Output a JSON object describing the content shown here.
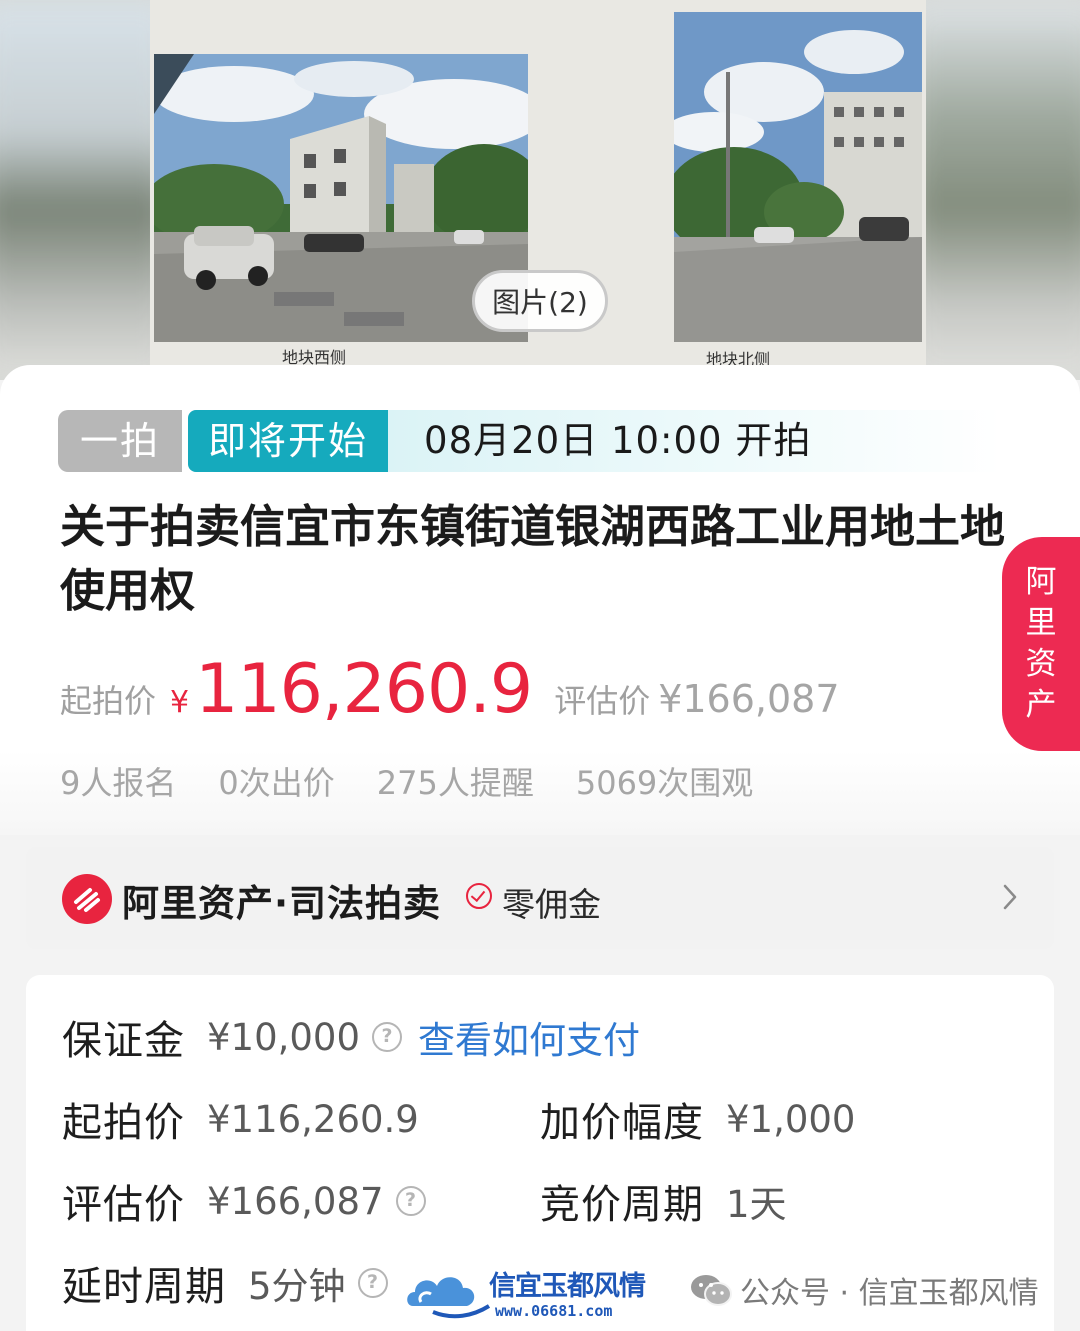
{
  "photo_strip": {
    "caption_left": "地块西侧",
    "caption_right": "地块北侧",
    "pager_label": "图片(2)"
  },
  "auction": {
    "round_tag": "一拍",
    "status_tag": "即将开始",
    "start_time": "08月20日 10:00 开拍",
    "title": "关于拍卖信宜市东镇街道银湖西路工业用地土地使用权",
    "starting_price_label": "起拍价",
    "currency": "¥",
    "starting_price": "116,260.9",
    "appraised_price_label": "评估价",
    "appraised_price": "¥166,087",
    "stats": [
      "9人报名",
      "0次出价",
      "275人提醒",
      "5069次围观"
    ],
    "side_tab_chars": [
      "阿",
      "里",
      "资",
      "产"
    ]
  },
  "platform": {
    "name": "阿里资产·司法拍卖",
    "badge": "零佣金"
  },
  "details": {
    "deposit_label": "保证金",
    "deposit_value": "¥10,000",
    "pay_link": "查看如何支付",
    "start_price_label": "起拍价",
    "start_price_value": "¥116,260.9",
    "increment_label": "加价幅度",
    "increment_value": "¥1,000",
    "appraise_label": "评估价",
    "appraise_value": "¥166,087",
    "period_label": "竞价周期",
    "period_value": "1天",
    "delay_label": "延时周期",
    "delay_value": "5分钟"
  },
  "watermarks": {
    "site_name": "信宜玉都风情",
    "site_url": "www.06681.com",
    "wechat": "公众号 · 信宜玉都风情"
  },
  "colors": {
    "accent_red": "#e8243f",
    "status_teal": "#15aabd",
    "link_blue": "#2f79d1"
  }
}
